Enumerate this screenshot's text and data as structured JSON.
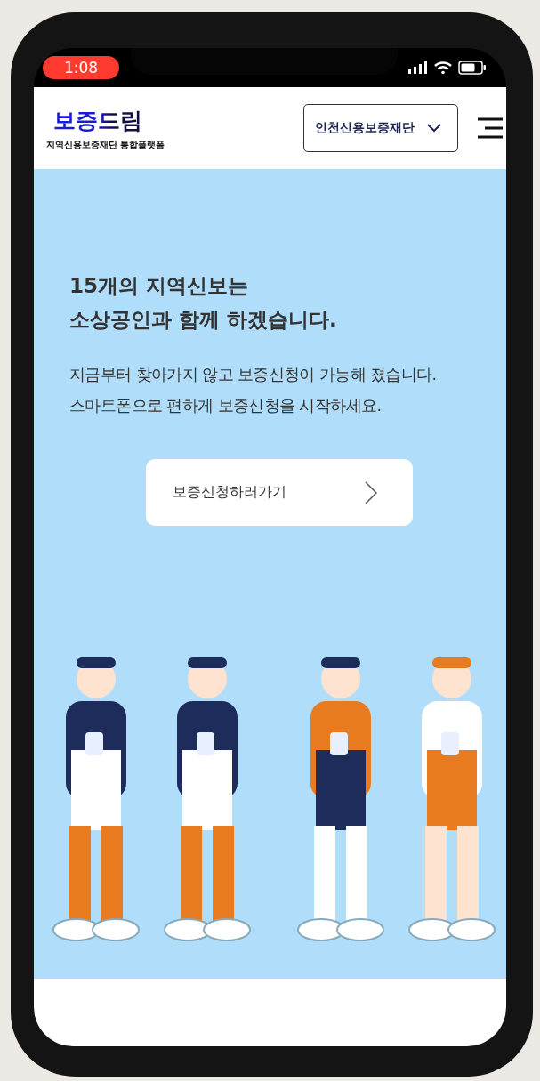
{
  "status_bar": {
    "time": "1:08"
  },
  "header": {
    "logo": "보증드림",
    "tagline": "지역신용보증재단 통합플랫폼",
    "region_select": {
      "value": "인천신용보증재단"
    }
  },
  "hero": {
    "headline": [
      "15개의 지역신보는",
      "소상공인과 함께 하겠습니다."
    ],
    "description": [
      "지금부터 찾아가지 않고 보증신청이 가능해 졌습니다.",
      "스마트폰으로 편하게 보증신청을 시작하세요."
    ],
    "cta": {
      "label": "보증신청하러가기"
    }
  }
}
